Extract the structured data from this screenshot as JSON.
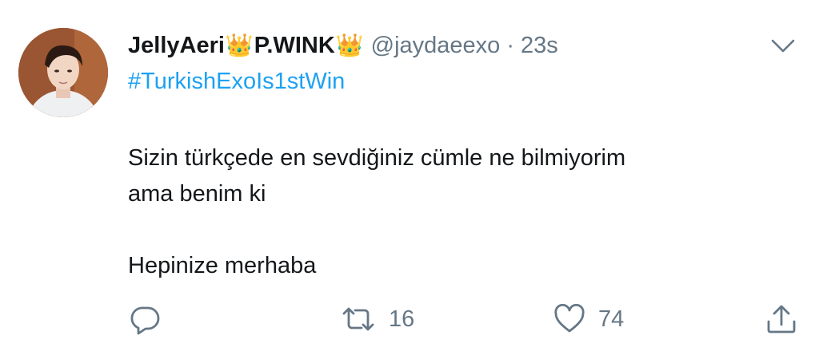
{
  "tweet": {
    "display_name": "JellyAeri",
    "crown_1": "👑",
    "display_name_2": "P.WINK",
    "crown_2": "👑",
    "handle": "@jaydaeexo",
    "separator": "·",
    "time": "23s",
    "hashtag": "#TurkishExoIs1stWin",
    "body_line_1": "Sizin türkçede en sevdiğiniz cümle ne bilmiyorim",
    "body_line_2": "ama benim ki",
    "body_line_3": "Hepinize merhaba"
  },
  "actions": {
    "reply_icon": "reply-icon",
    "retweet_icon": "retweet-icon",
    "retweet_count": "16",
    "like_icon": "heart-icon",
    "like_count": "74",
    "share_icon": "share-icon"
  },
  "menu_icon": "chevron-down-icon",
  "colors": {
    "text": "#14171a",
    "secondary": "#657786",
    "link": "#1da1f2",
    "background": "#ffffff"
  }
}
